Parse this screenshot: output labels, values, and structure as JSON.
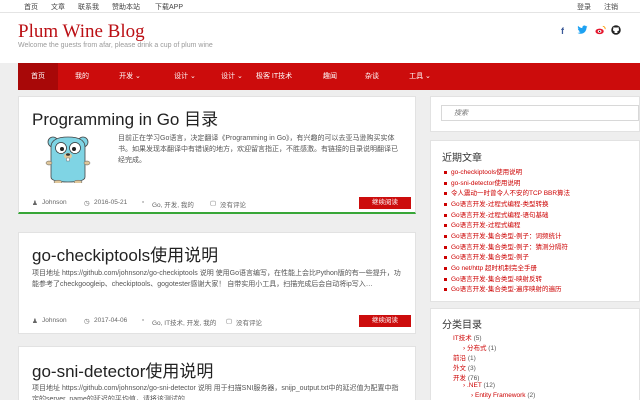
{
  "topbar": {
    "left": [
      "首页",
      "文章",
      "联系我",
      "赞助本站",
      "下载APP"
    ],
    "login": "登录",
    "logout": "注销"
  },
  "site": {
    "title": "Plum Wine Blog",
    "tagline": "Welcome the guests from afar, please drink a cup of plum wine"
  },
  "social": {
    "facebook": "f",
    "twitter": "t",
    "weibo": "w",
    "github": "g"
  },
  "nav": [
    {
      "label": "首页",
      "arrow": ""
    },
    {
      "label": "我的",
      "arrow": ""
    },
    {
      "label": "开发",
      "arrow": "⌄"
    },
    {
      "label": "设计",
      "arrow": "⌄"
    },
    {
      "label": "设计",
      "arrow": "⌄"
    },
    {
      "label": "极客",
      "arrow": ""
    },
    {
      "label": "IT技术",
      "arrow": ""
    },
    {
      "label": "趣闻",
      "arrow": ""
    },
    {
      "label": "杂谈",
      "arrow": ""
    },
    {
      "label": "工具",
      "arrow": "⌄"
    }
  ],
  "posts": [
    {
      "title": "Programming in Go 目录",
      "excerpt": "目前正在学习Go语言，决定翻译《Programming in Go》，有兴趣的可以去亚马逊购买实体书。如果发现本翻译中有错误的地方，欢迎留言指正，不胜感激。有链接的目录说明翻译已经完成。",
      "author": "Johnson",
      "date": "2016-05-21",
      "categories": "Go, 开发, 我的",
      "comments": "没有评论",
      "read_more": "继续阅读"
    },
    {
      "title": "go-checkiptools使用说明",
      "excerpt": "项目地址 https://github.com/johnsonz/go-checkiptools 说明 使用Go语言编写，在性能上会比Python版的有一些提升，功能参考了checkgoogleip、checkiptools、gogotester感谢大家！ 自带实用小工具，扫描完成后会自动将ip写入…",
      "author": "Johnson",
      "date": "2017-04-06",
      "categories": "Go, IT技术, 开发, 我的",
      "comments": "没有评论",
      "read_more": "继续阅读"
    },
    {
      "title": "go-sni-detector使用说明",
      "excerpt": "项目地址 https://github.com/johnsonz/go-sni-detector 说明 用于扫描SNI服务器，snijp_output.txt中的延迟值为配置中指定的server_name的延迟的平均值，请将该测试的",
      "author": "",
      "date": "",
      "categories": "",
      "comments": "",
      "read_more": ""
    }
  ],
  "search": {
    "placeholder": "搜索"
  },
  "recent": {
    "title": "近期文章",
    "items": [
      "go-checkiptools使用说明",
      "go-sni-detector使用说明",
      "令人震动一时曾令人不安的TCP BBR算法",
      "Go语言开发-过程式编程-类型转换",
      "Go语言开发-过程式编程-语句基础",
      "Go语言开发-过程式编程",
      "Go语言开发-集合类型-例子：词频统计",
      "Go语言开发-集合类型-例子：猜测分隔符",
      "Go语言开发-集合类型-例子",
      "Go net/http 超时机制完全手册",
      "Go语言开发-集合类型-映射反转",
      "Go语言开发-集合类型-遍序映射的遍历"
    ]
  },
  "categories": {
    "title": "分类目录",
    "items": [
      {
        "name": "IT技术",
        "count": "(5)"
      },
      {
        "name": "分布式",
        "count": "(1)"
      },
      {
        "name": "前沿",
        "count": "(1)"
      },
      {
        "name": "外文",
        "count": "(3)"
      },
      {
        "name": "开发",
        "count": "(76)"
      },
      {
        "name": ".NET",
        "count": "(12)"
      },
      {
        "name": "Entity Framework",
        "count": "(2)"
      }
    ]
  },
  "colors": {
    "brand": "#cc0c0c",
    "nav_active": "#a80808",
    "link": "#cc0000",
    "background": "#eeeeee"
  }
}
